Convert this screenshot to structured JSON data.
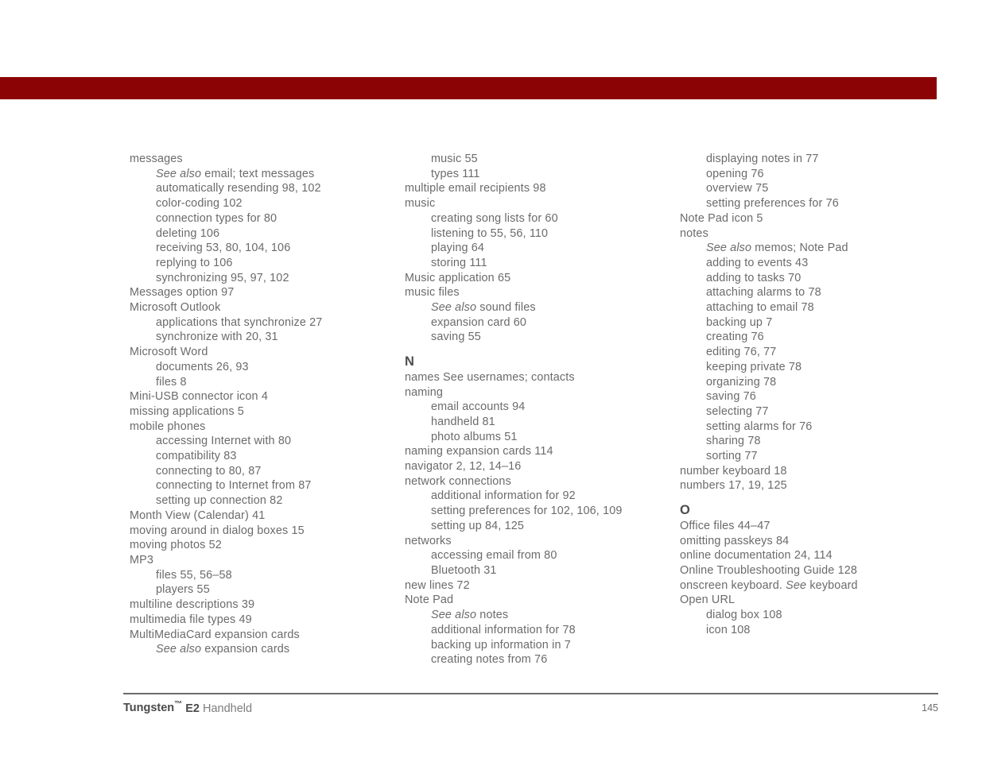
{
  "page": {
    "banner_color": "#8b0304",
    "text_color": "#6b6b6b",
    "number": "145"
  },
  "footer": {
    "brand": "Tungsten",
    "trademark": "™",
    "model": "E2",
    "kind": "Handheld",
    "page_number": "145"
  },
  "columns": [
    {
      "id": "column-1",
      "entries": [
        {
          "level": "main",
          "text": "messages"
        },
        {
          "level": "sub",
          "italic": "See also",
          "text": " email; text messages"
        },
        {
          "level": "sub",
          "text": "automatically resending 98, 102"
        },
        {
          "level": "sub",
          "text": "color-coding 102"
        },
        {
          "level": "sub",
          "text": "connection types for 80"
        },
        {
          "level": "sub",
          "text": "deleting 106"
        },
        {
          "level": "sub",
          "text": "receiving 53, 80, 104, 106"
        },
        {
          "level": "sub",
          "text": "replying to 106"
        },
        {
          "level": "sub",
          "text": "synchronizing 95, 97, 102"
        },
        {
          "level": "main",
          "text": "Messages option 97"
        },
        {
          "level": "main",
          "text": "Microsoft Outlook"
        },
        {
          "level": "sub",
          "text": "applications that synchronize 27"
        },
        {
          "level": "sub",
          "text": "synchronize with 20, 31"
        },
        {
          "level": "main",
          "text": "Microsoft Word"
        },
        {
          "level": "sub",
          "text": "documents 26, 93"
        },
        {
          "level": "sub",
          "text": "files 8"
        },
        {
          "level": "main",
          "text": "Mini-USB connector icon 4"
        },
        {
          "level": "main",
          "text": "missing applications 5"
        },
        {
          "level": "main",
          "text": "mobile phones"
        },
        {
          "level": "sub",
          "text": "accessing Internet with 80"
        },
        {
          "level": "sub",
          "text": "compatibility 83"
        },
        {
          "level": "sub",
          "text": "connecting to 80, 87"
        },
        {
          "level": "sub",
          "text": "connecting to Internet from 87"
        },
        {
          "level": "sub",
          "text": "setting up connection 82"
        },
        {
          "level": "main",
          "text": "Month View (Calendar) 41"
        },
        {
          "level": "main",
          "text": "moving around in dialog boxes 15"
        },
        {
          "level": "main",
          "text": "moving photos 52"
        },
        {
          "level": "main",
          "text": "MP3"
        },
        {
          "level": "sub",
          "text": "files 55, 56–58"
        },
        {
          "level": "sub",
          "text": "players 55"
        },
        {
          "level": "main",
          "text": "multiline descriptions 39"
        },
        {
          "level": "main",
          "text": "multimedia file types 49"
        },
        {
          "level": "main",
          "text": "MultiMediaCard expansion cards"
        },
        {
          "level": "sub",
          "italic": "See also",
          "text": " expansion cards"
        }
      ]
    },
    {
      "id": "column-2",
      "entries": [
        {
          "level": "sub",
          "text": "music 55"
        },
        {
          "level": "sub",
          "text": "types 111"
        },
        {
          "level": "main",
          "text": "multiple email recipients 98"
        },
        {
          "level": "main",
          "text": "music"
        },
        {
          "level": "sub",
          "text": "creating song lists for 60"
        },
        {
          "level": "sub",
          "text": "listening to 55, 56, 110"
        },
        {
          "level": "sub",
          "text": "playing 64"
        },
        {
          "level": "sub",
          "text": "storing 111"
        },
        {
          "level": "main",
          "text": "Music application 65"
        },
        {
          "level": "main",
          "text": "music files"
        },
        {
          "level": "sub",
          "italic": "See also",
          "text": " sound files"
        },
        {
          "level": "sub",
          "text": "expansion card 60"
        },
        {
          "level": "sub",
          "text": "saving 55"
        },
        {
          "level": "letter",
          "text": "N"
        },
        {
          "level": "main",
          "text": "names See usernames; contacts"
        },
        {
          "level": "main",
          "text": "naming"
        },
        {
          "level": "sub",
          "text": "email accounts 94"
        },
        {
          "level": "sub",
          "text": "handheld 81"
        },
        {
          "level": "sub",
          "text": "photo albums 51"
        },
        {
          "level": "main",
          "text": "naming expansion cards 114"
        },
        {
          "level": "main",
          "text": "navigator 2, 12, 14–16"
        },
        {
          "level": "main",
          "text": "network connections"
        },
        {
          "level": "sub",
          "text": "additional information for 92"
        },
        {
          "level": "sub",
          "text": "setting preferences for 102, 106, 109"
        },
        {
          "level": "sub",
          "text": "setting up 84, 125"
        },
        {
          "level": "main",
          "text": "networks"
        },
        {
          "level": "sub",
          "text": "accessing email from 80"
        },
        {
          "level": "sub",
          "text": "Bluetooth 31"
        },
        {
          "level": "main",
          "text": "new lines 72"
        },
        {
          "level": "main",
          "text": "Note Pad"
        },
        {
          "level": "sub",
          "italic": "See also",
          "text": " notes"
        },
        {
          "level": "sub",
          "text": "additional information for 78"
        },
        {
          "level": "sub",
          "text": "backing up information in 7"
        },
        {
          "level": "sub",
          "text": "creating notes from 76"
        }
      ]
    },
    {
      "id": "column-3",
      "entries": [
        {
          "level": "sub",
          "text": "displaying notes in 77"
        },
        {
          "level": "sub",
          "text": "opening 76"
        },
        {
          "level": "sub",
          "text": "overview 75"
        },
        {
          "level": "sub",
          "text": "setting preferences for 76"
        },
        {
          "level": "main",
          "text": "Note Pad icon 5"
        },
        {
          "level": "main",
          "text": "notes"
        },
        {
          "level": "sub",
          "italic": "See also",
          "text": " memos; Note Pad"
        },
        {
          "level": "sub",
          "text": "adding to events 43"
        },
        {
          "level": "sub",
          "text": "adding to tasks 70"
        },
        {
          "level": "sub",
          "text": "attaching alarms to 78"
        },
        {
          "level": "sub",
          "text": "attaching to email 78"
        },
        {
          "level": "sub",
          "text": "backing up 7"
        },
        {
          "level": "sub",
          "text": "creating 76"
        },
        {
          "level": "sub",
          "text": "editing 76, 77"
        },
        {
          "level": "sub",
          "text": "keeping private 78"
        },
        {
          "level": "sub",
          "text": "organizing 78"
        },
        {
          "level": "sub",
          "text": "saving 76"
        },
        {
          "level": "sub",
          "text": "selecting 77"
        },
        {
          "level": "sub",
          "text": "setting alarms for 76"
        },
        {
          "level": "sub",
          "text": "sharing 78"
        },
        {
          "level": "sub",
          "text": "sorting 77"
        },
        {
          "level": "main",
          "text": "number keyboard 18"
        },
        {
          "level": "main",
          "text": "numbers 17, 19, 125"
        },
        {
          "level": "letter",
          "text": "O"
        },
        {
          "level": "main",
          "text": "Office files 44–47"
        },
        {
          "level": "main",
          "text": "omitting passkeys 84"
        },
        {
          "level": "main",
          "text": "online documentation 24, 114"
        },
        {
          "level": "main",
          "text": "Online Troubleshooting Guide 128"
        },
        {
          "level": "main",
          "italic_mid": "See",
          "text_before": "onscreen keyboard. ",
          "text_after": " keyboard"
        },
        {
          "level": "main",
          "text": "Open URL"
        },
        {
          "level": "sub",
          "text": "dialog box 108"
        },
        {
          "level": "sub",
          "text": "icon 108"
        }
      ]
    }
  ]
}
